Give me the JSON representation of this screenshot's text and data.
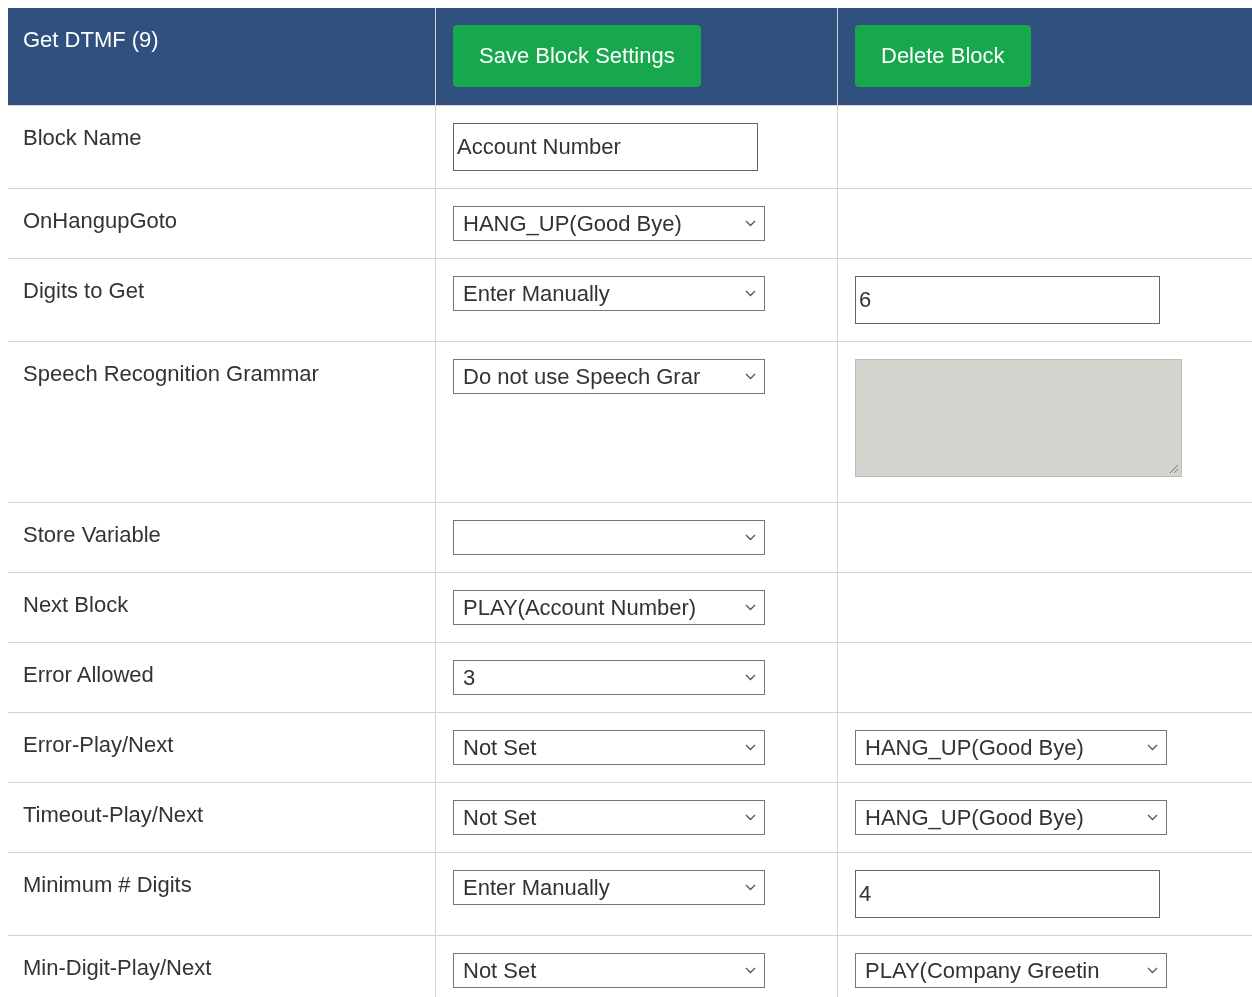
{
  "header": {
    "title": "Get DTMF (9)",
    "buttons": [
      "Save Block Settings",
      "Delete Block"
    ]
  },
  "rows": [
    {
      "label": "Block Name",
      "control": {
        "kind": "input",
        "value": "Account Number"
      }
    },
    {
      "label": "OnHangupGoto",
      "control": {
        "kind": "select",
        "value": "HANG_UP(Good Bye)"
      }
    },
    {
      "label": "Digits to Get",
      "control": {
        "kind": "select",
        "value": "Enter Manually"
      },
      "extra": {
        "kind": "input",
        "value": "6"
      }
    },
    {
      "label": "Speech Recognition Grammar",
      "control": {
        "kind": "select",
        "value": "Do not use Speech Grar"
      },
      "extra": {
        "kind": "textarea",
        "disabled": true
      }
    },
    {
      "label": "Store Variable",
      "control": {
        "kind": "select"
      }
    },
    {
      "label": "Next Block",
      "control": {
        "kind": "select",
        "value": "PLAY(Account Number)"
      }
    },
    {
      "label": "Error Allowed",
      "control": {
        "kind": "select",
        "value": "3"
      }
    },
    {
      "label": "Error-Play/Next",
      "control": {
        "kind": "select",
        "value": "Not Set"
      },
      "extra": {
        "kind": "select",
        "value": "HANG_UP(Good Bye)"
      }
    },
    {
      "label": "Timeout-Play/Next",
      "control": {
        "kind": "select",
        "value": "Not Set"
      },
      "extra": {
        "kind": "select",
        "value": "HANG_UP(Good Bye)"
      }
    },
    {
      "label": "Minimum # Digits",
      "control": {
        "kind": "select",
        "value": "Enter Manually"
      },
      "extra": {
        "kind": "input",
        "value": "4"
      }
    },
    {
      "label": "Min-Digit-Play/Next",
      "control": {
        "kind": "select",
        "value": "Not Set"
      },
      "extra": {
        "kind": "select",
        "value": "PLAY(Company Greetin"
      }
    }
  ]
}
